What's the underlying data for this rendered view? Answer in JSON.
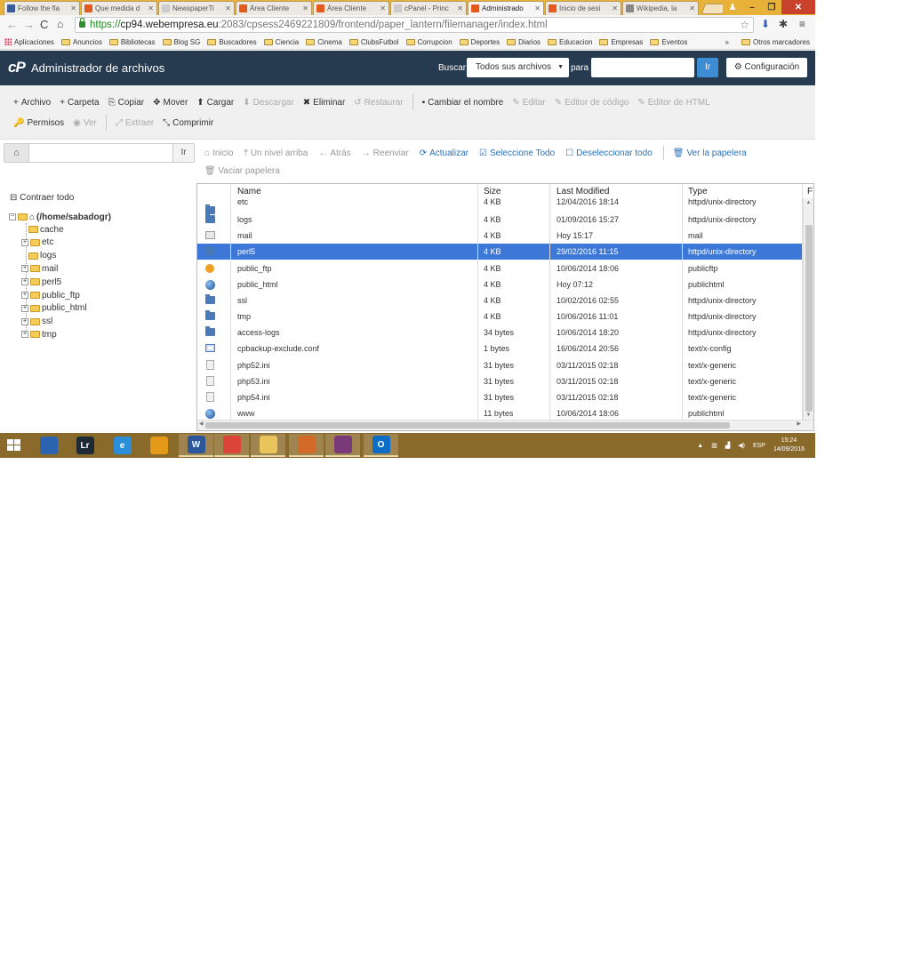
{
  "browser": {
    "tabs": [
      {
        "title": "Follow the fla",
        "fav": "#3a5c9c"
      },
      {
        "title": "Que medida d",
        "fav": "#e35a1e"
      },
      {
        "title": "NewspaperTi",
        "fav": "#cccccc"
      },
      {
        "title": "Área Cliente",
        "fav": "#e35a1e"
      },
      {
        "title": "Área Cliente",
        "fav": "#e35a1e"
      },
      {
        "title": "cPanel - Princ",
        "fav": "#cccccc"
      },
      {
        "title": "Administrado",
        "fav": "#e35a1e"
      },
      {
        "title": "Inicio de sesi",
        "fav": "#e35a1e"
      },
      {
        "title": "Wikipedia, la",
        "fav": "#888888"
      }
    ],
    "url": {
      "proto": "https://",
      "host": "cp94.webempresa.eu",
      "path": ":2083/cpsess2469221809/frontend/paper_lantern/filemanager/index.html"
    },
    "bookmarks": [
      "Aplicaciones",
      "Anuncios",
      "Bibliotecas",
      "Blog SG",
      "Buscadores",
      "Ciencia",
      "Cinema",
      "ClubsFutbol",
      "Corrupcion",
      "Deportes",
      "Diarios",
      "Educacion",
      "Empresas",
      "Eventos"
    ],
    "bookmarks_more": "»",
    "other_bookmarks": "Otros marcadores"
  },
  "header": {
    "logo": "cP",
    "title": "Administrador de archivos",
    "search_label": "Buscar",
    "scope": "Todos sus archivos",
    "para_label": "para",
    "search_value": "",
    "go_label": "Ir",
    "settings_label": "Configuración"
  },
  "toolbar": {
    "row1": [
      {
        "icon": "+",
        "label": "Archivo",
        "disabled": false,
        "name": "new-file-button"
      },
      {
        "icon": "+",
        "label": "Carpeta",
        "disabled": false,
        "name": "new-folder-button"
      },
      {
        "icon": "⎘",
        "label": "Copiar",
        "disabled": false,
        "name": "copy-button"
      },
      {
        "icon": "✥",
        "label": "Mover",
        "disabled": false,
        "name": "move-button"
      },
      {
        "icon": "⬆",
        "label": "Cargar",
        "disabled": false,
        "name": "upload-button"
      },
      {
        "icon": "⬇",
        "label": "Descargar",
        "disabled": true,
        "name": "download-button"
      },
      {
        "icon": "✖",
        "label": "Eliminar",
        "disabled": false,
        "name": "delete-button"
      },
      {
        "icon": "↺",
        "label": "Restaurar",
        "disabled": true,
        "name": "restore-button"
      },
      {
        "icon": "▪",
        "label": "Cambiar el nombre",
        "disabled": false,
        "name": "rename-button"
      },
      {
        "icon": "✎",
        "label": "Editar",
        "disabled": true,
        "name": "edit-button"
      },
      {
        "icon": "✎",
        "label": "Editor de código",
        "disabled": true,
        "name": "code-editor-button"
      },
      {
        "icon": "✎",
        "label": "Editor de HTML",
        "disabled": true,
        "name": "html-editor-button"
      }
    ],
    "row2": [
      {
        "icon": "🔑",
        "label": "Permisos",
        "disabled": false,
        "name": "permissions-button"
      },
      {
        "icon": "◉",
        "label": "Ver",
        "disabled": true,
        "name": "view-button"
      },
      {
        "icon": "⤢",
        "label": "Extraer",
        "disabled": true,
        "name": "extract-button"
      },
      {
        "icon": "⤡",
        "label": "Comprimir",
        "disabled": false,
        "name": "compress-button"
      }
    ]
  },
  "pathbar": {
    "value": "",
    "go_label": "Ir"
  },
  "nav": {
    "buttons": [
      {
        "icon": "⌂",
        "label": "Inicio",
        "style": "grey",
        "name": "home-nav-button"
      },
      {
        "icon": "⤒",
        "label": "Un nivel arriba",
        "style": "grey",
        "name": "up-level-button"
      },
      {
        "icon": "←",
        "label": "Atrás",
        "style": "grey",
        "name": "back-button"
      },
      {
        "icon": "→",
        "label": "Reenviar",
        "style": "grey",
        "name": "forward-button"
      },
      {
        "icon": "⟳",
        "label": "Actualizar",
        "style": "blue",
        "name": "refresh-button"
      },
      {
        "icon": "☑",
        "label": "Seleccione Todo",
        "style": "blue",
        "name": "select-all-button"
      },
      {
        "icon": "☐",
        "label": "Deseleccionar todo",
        "style": "blue",
        "name": "deselect-all-button"
      },
      {
        "icon": "🗑",
        "label": "Ver la papelera",
        "style": "blue",
        "name": "view-trash-button"
      }
    ],
    "empty_trash": "Vaciar papelera"
  },
  "tree": {
    "collapse_label": "Contraer todo",
    "root": "(/home/sabadogr)",
    "items": [
      {
        "label": "cache",
        "expand": false
      },
      {
        "label": "etc",
        "expand": true
      },
      {
        "label": "logs",
        "expand": false
      },
      {
        "label": "mail",
        "expand": true
      },
      {
        "label": "perl5",
        "expand": true
      },
      {
        "label": "public_ftp",
        "expand": true
      },
      {
        "label": "public_html",
        "expand": true
      },
      {
        "label": "ssl",
        "expand": true
      },
      {
        "label": "tmp",
        "expand": true
      }
    ]
  },
  "grid": {
    "columns": [
      "Name",
      "Size",
      "Last Modified",
      "Type",
      "F"
    ],
    "rows": [
      {
        "name": "etc",
        "size": "4 KB",
        "modified": "12/04/2016 18:14",
        "type": "httpd/unix-directory",
        "icon": "dir",
        "selected": false
      },
      {
        "name": "logs",
        "size": "4 KB",
        "modified": "01/09/2016 15:27",
        "type": "httpd/unix-directory",
        "icon": "dir",
        "selected": false
      },
      {
        "name": "mail",
        "size": "4 KB",
        "modified": "Hoy 15:17",
        "type": "mail",
        "icon": "mail",
        "selected": false
      },
      {
        "name": "perl5",
        "size": "4 KB",
        "modified": "29/02/2016 11:15",
        "type": "httpd/unix-directory",
        "icon": "dir",
        "selected": true
      },
      {
        "name": "public_ftp",
        "size": "4 KB",
        "modified": "10/06/2014 18:06",
        "type": "publicftp",
        "icon": "ftp",
        "selected": false
      },
      {
        "name": "public_html",
        "size": "4 KB",
        "modified": "Hoy 07:12",
        "type": "publichtml",
        "icon": "globe",
        "selected": false
      },
      {
        "name": "ssl",
        "size": "4 KB",
        "modified": "10/02/2016 02:55",
        "type": "httpd/unix-directory",
        "icon": "dir",
        "selected": false
      },
      {
        "name": "tmp",
        "size": "4 KB",
        "modified": "10/06/2016 11:01",
        "type": "httpd/unix-directory",
        "icon": "dir",
        "selected": false
      },
      {
        "name": "access-logs",
        "size": "34 bytes",
        "modified": "10/06/2014 18:20",
        "type": "httpd/unix-directory",
        "icon": "dir",
        "selected": false
      },
      {
        "name": "cpbackup-exclude.conf",
        "size": "1 bytes",
        "modified": "16/06/2014 20:56",
        "type": "text/x-config",
        "icon": "cfg",
        "selected": false
      },
      {
        "name": "php52.ini",
        "size": "31 bytes",
        "modified": "03/11/2015 02:18",
        "type": "text/x-generic",
        "icon": "txt",
        "selected": false
      },
      {
        "name": "php53.ini",
        "size": "31 bytes",
        "modified": "03/11/2015 02:18",
        "type": "text/x-generic",
        "icon": "txt",
        "selected": false
      },
      {
        "name": "php54.ini",
        "size": "31 bytes",
        "modified": "03/11/2015 02:18",
        "type": "text/x-generic",
        "icon": "txt",
        "selected": false
      },
      {
        "name": "www",
        "size": "11 bytes",
        "modified": "10/06/2014 18:06",
        "type": "publichtml",
        "icon": "globe",
        "selected": false
      }
    ]
  },
  "taskbar": {
    "apps": [
      {
        "name": "lync-taskbar-icon",
        "label": "",
        "color": "#2b63b0",
        "open": false
      },
      {
        "name": "lightroom-taskbar-icon",
        "label": "Lr",
        "color": "#1d2a35",
        "open": false
      },
      {
        "name": "internet-explorer-taskbar-icon",
        "label": "e",
        "color": "#2a8fd8",
        "open": false
      },
      {
        "name": "app-taskbar-icon",
        "label": "",
        "color": "#e49a18",
        "open": false
      },
      {
        "name": "word-taskbar-icon",
        "label": "W",
        "color": "#2b579a",
        "open": true
      },
      {
        "name": "chrome-taskbar-icon",
        "label": "",
        "color": "#db4437",
        "open": true
      },
      {
        "name": "file-explorer-taskbar-icon",
        "label": "",
        "color": "#e8c45a",
        "open": true
      },
      {
        "name": "paint-taskbar-icon",
        "label": "",
        "color": "#d46a2a",
        "open": true
      },
      {
        "name": "winrar-taskbar-icon",
        "label": "",
        "color": "#7a3a7a",
        "open": true
      },
      {
        "name": "outlook-taskbar-icon",
        "label": "O",
        "color": "#0a6ec6",
        "open": true
      }
    ],
    "language": "ESP",
    "time": "15:24",
    "date": "14/09/2016"
  }
}
